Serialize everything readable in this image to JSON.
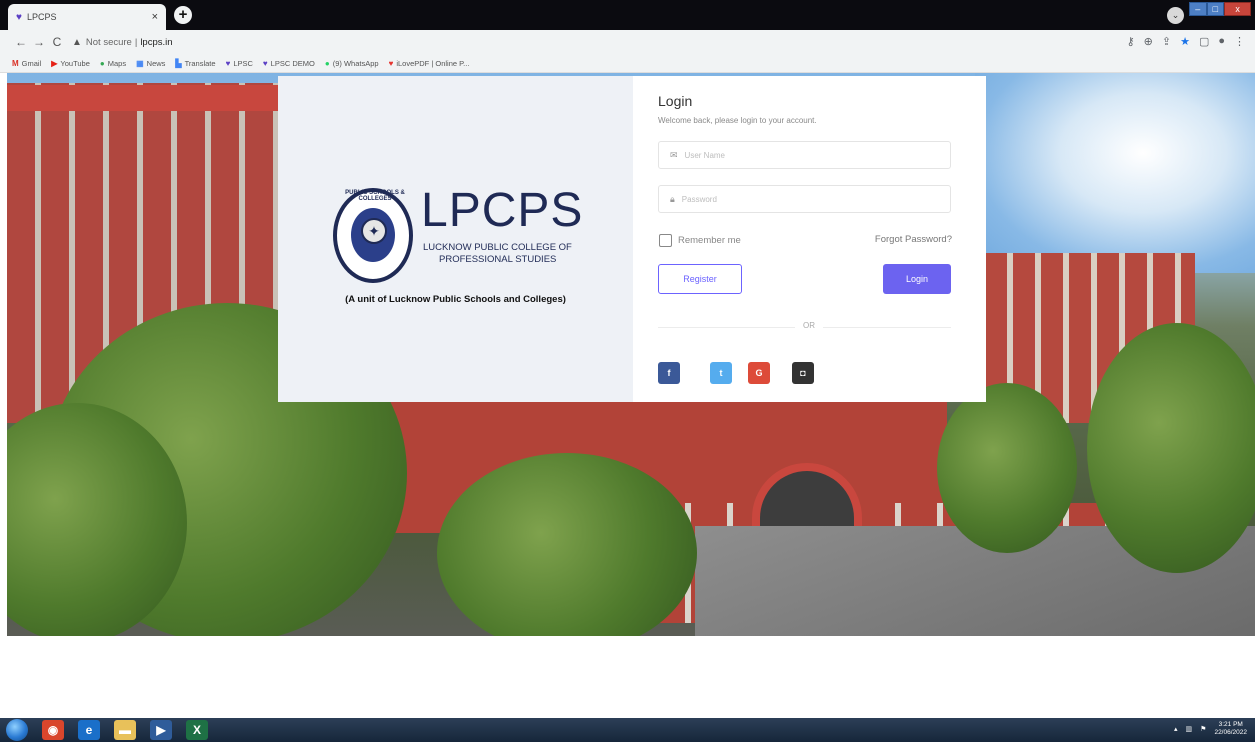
{
  "browser": {
    "tab_title": "LPCPS",
    "tab_close": "×",
    "new_tab": "+",
    "not_secure": "Not secure",
    "separator": "|",
    "url": "lpcps.in",
    "bookmarks": [
      {
        "label": "Gmail",
        "icon": "gmail-icon",
        "glyph": "M",
        "color": "#d93025"
      },
      {
        "label": "YouTube",
        "icon": "youtube-icon",
        "glyph": "▶",
        "color": "#e62117"
      },
      {
        "label": "Maps",
        "icon": "maps-icon",
        "glyph": "●",
        "color": "#34a853"
      },
      {
        "label": "News",
        "icon": "news-icon",
        "glyph": "▦",
        "color": "#4285f4"
      },
      {
        "label": "Translate",
        "icon": "translate-icon",
        "glyph": "▙",
        "color": "#4285f4"
      },
      {
        "label": "LPSC",
        "icon": "lpsc-icon",
        "glyph": "♥",
        "color": "#5b3fc4"
      },
      {
        "label": "LPSC DEMO",
        "icon": "lpsc-icon",
        "glyph": "♥",
        "color": "#5b3fc4"
      },
      {
        "label": "(9) WhatsApp",
        "icon": "whatsapp-icon",
        "glyph": "●",
        "color": "#25d366"
      },
      {
        "label": "iLovePDF | Online P...",
        "icon": "ilovepdf-icon",
        "glyph": "♥",
        "color": "#e5322d"
      }
    ]
  },
  "brand": {
    "name": "LPCPS",
    "sub_line1": "LUCKNOW PUBLIC COLLEGE OF",
    "sub_line2": "PROFESSIONAL STUDIES",
    "emblem_text": "PUBLIC SCHOOLS & COLLEGES",
    "tagline": "(A unit of Lucknow Public Schools and Colleges)"
  },
  "login": {
    "title": "Login",
    "subtitle": "Welcome back, please login to your account.",
    "username_placeholder": "User Name",
    "password_placeholder": "Password",
    "remember_label": "Remember me",
    "forgot_label": "Forgot Password?",
    "register_label": "Register",
    "login_label": "Login",
    "or_label": "OR",
    "social": [
      {
        "name": "facebook",
        "glyph": "f",
        "color": "#3b5998"
      },
      {
        "name": "twitter",
        "glyph": "t",
        "color": "#55acee"
      },
      {
        "name": "google",
        "glyph": "G",
        "color": "#dd4b39"
      },
      {
        "name": "github",
        "glyph": "◘",
        "color": "#333333"
      }
    ]
  },
  "taskbar": {
    "time": "3:21 PM",
    "date": "22/06/2022",
    "apps": [
      {
        "name": "chrome",
        "color": "#d9462c",
        "glyph": "◉"
      },
      {
        "name": "ie",
        "color": "#1a6fc9",
        "glyph": "e"
      },
      {
        "name": "explorer",
        "color": "#e8c15a",
        "glyph": "▬"
      },
      {
        "name": "media",
        "color": "#2f5c9a",
        "glyph": "▶"
      },
      {
        "name": "excel",
        "color": "#1e7145",
        "glyph": "X"
      }
    ]
  }
}
